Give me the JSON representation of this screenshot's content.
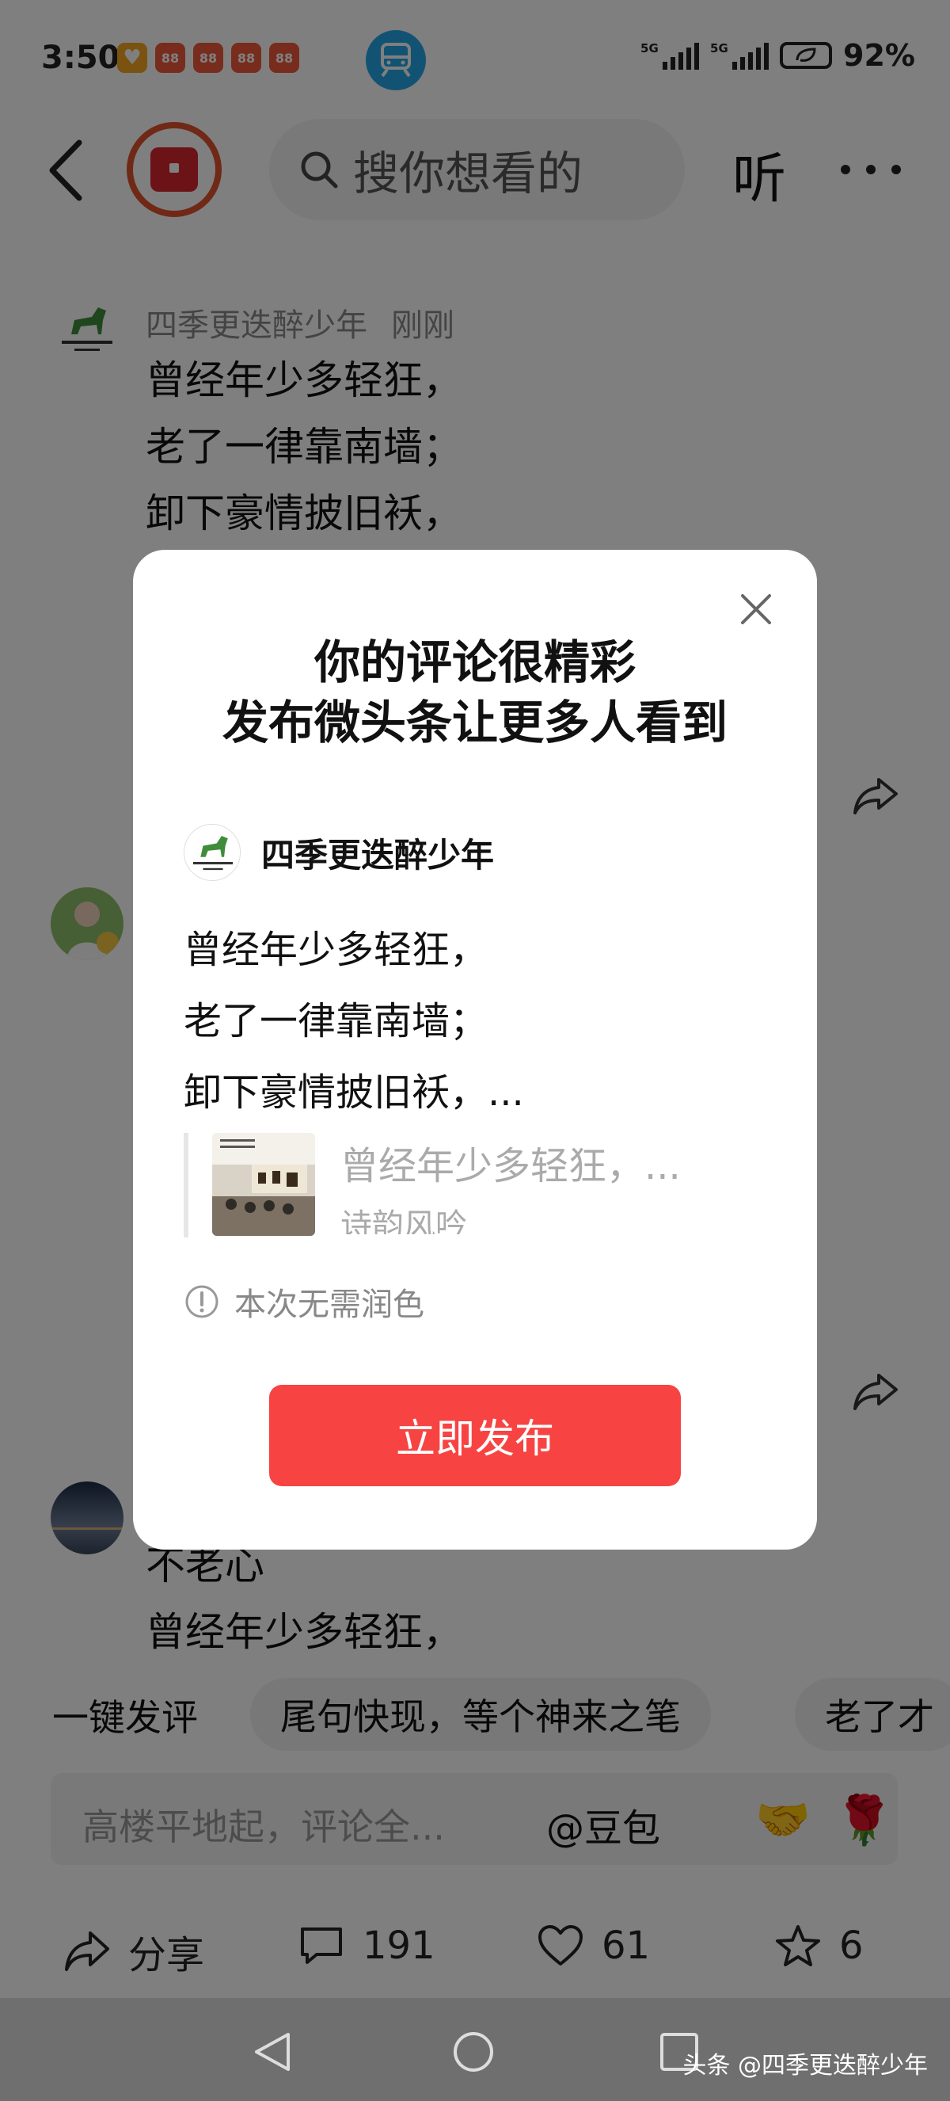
{
  "status_bar": {
    "time": "3:50",
    "app_badges": [
      "♥",
      "88",
      "88",
      "88",
      "88"
    ],
    "signal_1": "5G",
    "signal_2": "5G",
    "battery": "92%"
  },
  "top_bar": {
    "search_placeholder": "搜你想看的",
    "listen_label": "听"
  },
  "comments": [
    {
      "author": "四季更迭醉少年",
      "time": "刚刚",
      "lines": [
        "曾经年少多轻狂，",
        "老了一律靠南墙；",
        "卸下豪情披旧袄，"
      ]
    },
    {
      "lines": [
        "不老心",
        "曾经年少多轻狂，"
      ]
    }
  ],
  "suggestions": {
    "lead": "一键发评",
    "chips": [
      "尾句快现，等个神来之笔",
      "老了才"
    ]
  },
  "composer": {
    "placeholder": "高楼平地起，评论全...",
    "mention": "@豆包",
    "emoji_1": "🤝",
    "emoji_2": "🌹"
  },
  "actions": {
    "share": "分享",
    "comments": "191",
    "likes": "61",
    "favorites": "6"
  },
  "nav": {
    "watermark": "头条 @四季更迭醉少年"
  },
  "modal": {
    "title_line1": "你的评论很精彩",
    "title_line2": "发布微头条让更多人看到",
    "author": "四季更迭醉少年",
    "lines": [
      "曾经年少多轻狂，",
      "老了一律靠南墙；",
      "卸下豪情披旧袄，..."
    ],
    "quote_title": "曾经年少多轻狂，...",
    "quote_source": "诗韵风吟",
    "note": "本次无需润色",
    "publish_button": "立即发布"
  },
  "colors": {
    "accent": "#f84343",
    "overlay": "rgba(0,0,0,0.5)",
    "navbar": "#6f6f6f"
  }
}
